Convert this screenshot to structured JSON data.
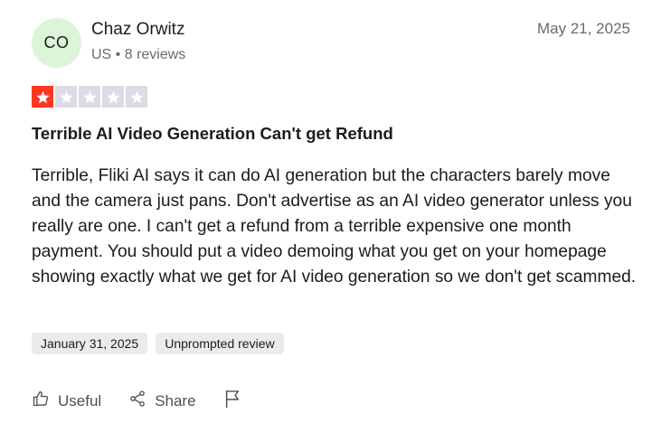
{
  "reviewer": {
    "initials": "CO",
    "name": "Chaz Orwitz",
    "meta": "US • 8 reviews",
    "avatar_color": "#dcf5d8"
  },
  "review": {
    "date": "May 21, 2025",
    "rating": 1,
    "max_rating": 5,
    "star_active_color": "#ff3722",
    "star_inactive_color": "#dcdce6",
    "title": "Terrible AI Video Generation Can't get Refund",
    "body": "Terrible, Fliki AI says it can do AI generation but the characters barely move and the camera just pans. Don't advertise as an AI video generator unless you really are one. I can't get a refund from a terrible expensive one month payment. You should put a video demoing what you get on your homepage showing exactly what we get for AI video generation so we don't get scammed."
  },
  "tags": {
    "experience_date": "January 31, 2025",
    "review_type": "Unprompted review"
  },
  "actions": {
    "useful_label": "Useful",
    "share_label": "Share",
    "useful_icon": "thumbs-up-icon",
    "share_icon": "share-icon",
    "flag_icon": "flag-icon"
  }
}
